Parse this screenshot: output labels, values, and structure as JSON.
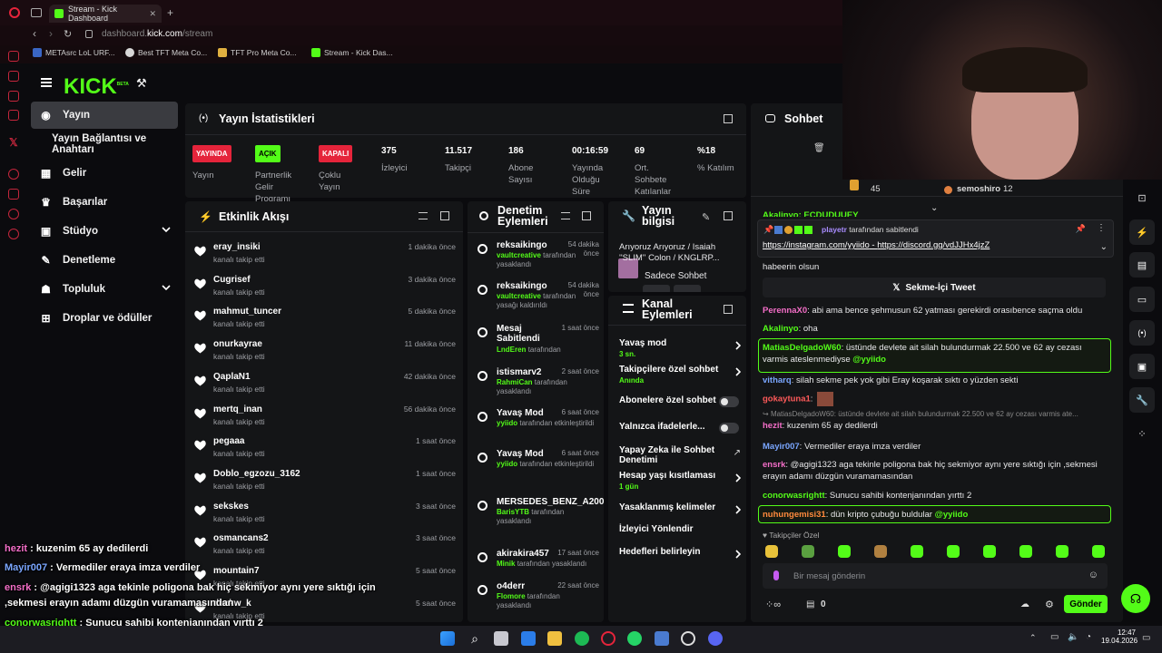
{
  "browser": {
    "tab_title": "Stream - Kick Dashboard",
    "url_prefix": "dashboard.",
    "url_domain": "kick.com",
    "url_path": "/stream",
    "bookmarks": [
      "METAsrc LoL URF...",
      "Best TFT Meta Co...",
      "TFT Pro Meta Co...",
      "Stream - Kick Das..."
    ]
  },
  "nav": {
    "logo": "KICK",
    "logo_beta": "BETA",
    "items": [
      "Yayın",
      "Yayın Bağlantısı ve Anahtarı",
      "Gelir",
      "Başarılar",
      "Stüdyo",
      "Denetleme",
      "Topluluk",
      "Droplar ve ödüller"
    ]
  },
  "stats": {
    "title": "Yayın İstatistikleri",
    "items": [
      {
        "badge": "YAYINDA",
        "label": "Yayın",
        "badge_color": "#e5243b"
      },
      {
        "badge": "AÇIK",
        "label": "Partnerlik Gelir Programı",
        "badge_color": "#53fc18"
      },
      {
        "badge": "KAPALI",
        "label": "Çoklu Yayın",
        "badge_color": "#e5243b"
      },
      {
        "value": "375",
        "label": "İzleyici"
      },
      {
        "value": "11.517",
        "label": "Takipçi"
      },
      {
        "value": "186",
        "label": "Abone Sayısı"
      },
      {
        "value": "00:16:59",
        "label": "Yayında Olduğu Süre"
      },
      {
        "value": "69",
        "label": "Ort. Sohbete Katılanlar"
      },
      {
        "value": "%18",
        "label": "% Katılım"
      }
    ]
  },
  "activity": {
    "title": "Etkinlik Akışı",
    "items": [
      {
        "name": "eray_insiki",
        "sub": "kanalı takip etti",
        "time": "1 dakika önce"
      },
      {
        "name": "Cugrisef",
        "sub": "kanalı takip etti",
        "time": "3 dakika önce"
      },
      {
        "name": "mahmut_tuncer",
        "sub": "kanalı takip etti",
        "time": "5 dakika önce"
      },
      {
        "name": "onurkayrae",
        "sub": "kanalı takip etti",
        "time": "11 dakika önce"
      },
      {
        "name": "QaplaN1",
        "sub": "kanalı takip etti",
        "time": "42 dakika önce"
      },
      {
        "name": "mertq_inan",
        "sub": "kanalı takip etti",
        "time": "56 dakika önce"
      },
      {
        "name": "pegaaa",
        "sub": "kanalı takip etti",
        "time": "1 saat önce"
      },
      {
        "name": "Doblo_egzozu_3162",
        "sub": "kanalı takip etti",
        "time": "1 saat önce"
      },
      {
        "name": "sekskes",
        "sub": "kanalı takip etti",
        "time": "3 saat önce"
      },
      {
        "name": "osmancans2",
        "sub": "kanalı takip etti",
        "time": "3 saat önce"
      },
      {
        "name": "mountain7",
        "sub": "kanalı takip etti",
        "time": "5 saat önce"
      },
      {
        "name": "deakw_k",
        "sub": "kanalı takip etti",
        "time": "5 saat önce"
      }
    ]
  },
  "moderation": {
    "title": "Denetim Eylemleri",
    "items": [
      {
        "name": "reksaikingo",
        "time": "54 dakika önce",
        "who": "vaultcreative",
        "sub": "tarafından yasaklandı"
      },
      {
        "name": "reksaikingo",
        "time": "54 dakika önce",
        "who": "vaultcreative",
        "sub": "tarafından yasağı kaldırıldı"
      },
      {
        "name": "Mesaj Sabitlendi",
        "time": "1 saat önce",
        "who": "LndEren",
        "sub": "tarafından"
      },
      {
        "name": "istismarv2",
        "time": "2 saat önce",
        "who": "RahmiCan",
        "sub": "tarafından yasaklandı"
      },
      {
        "name": "Yavaş Mod",
        "time": "6 saat önce",
        "who": "yyiido",
        "sub": "tarafından etkinleştirildi"
      },
      {
        "name": "Yavaş Mod",
        "time": "6 saat önce",
        "who": "yyiido",
        "sub": "tarafından etkinleştirildi"
      },
      {
        "name": "MERSEDES_BENZ_A200",
        "time": "",
        "who": "BarisYTB",
        "sub": "tarafından yasaklandı"
      },
      {
        "name": "akirakira457",
        "time": "17 saat önce",
        "who": "Minik",
        "sub": "tarafından yasaklandı"
      },
      {
        "name": "o4derr",
        "time": "22 saat önce",
        "who": "Flomore",
        "sub": "tarafından yasaklandı"
      }
    ]
  },
  "stream_info": {
    "title": "Yayın bilgisi",
    "stream_title": "Arıyoruz Arıyoruz / Isaiah ''SLIM'' Colon / KNGLRP...",
    "category": "Sadece Sohbet"
  },
  "channel_actions": {
    "title": "Kanal Eylemleri",
    "items": [
      {
        "label": "Yavaş mod",
        "sub": "3 sn.",
        "type": "arrow"
      },
      {
        "label": "Takipçilere özel sohbet",
        "sub": "Anında",
        "type": "arrow"
      },
      {
        "label": "Abonelere özel sohbet",
        "sub": "",
        "type": "toggle"
      },
      {
        "label": "Yalnızca ifadelerle...",
        "sub": "",
        "type": "toggle"
      },
      {
        "label": "Yapay Zeka ile Sohbet Denetimi",
        "sub": "",
        "type": "link"
      },
      {
        "label": "Hesap yaşı kısıtlaması",
        "sub": "1 gün",
        "type": "arrow"
      },
      {
        "label": "Yasaklanmış kelimeler",
        "sub": "",
        "type": "arrow"
      },
      {
        "label": "İzleyici Yönlendir",
        "sub": "",
        "type": "none"
      },
      {
        "label": "Hedefleri belirleyin",
        "sub": "",
        "type": "arrow"
      }
    ]
  },
  "chat": {
    "title": "Sohbet",
    "top_gifters": [
      {
        "count": "45"
      },
      {
        "name": "semoshiro",
        "count": "12"
      }
    ],
    "partial_top": "Akalinyo: ECDUDUUEY",
    "pinned": {
      "by": "playetr",
      "by_suffix": "tarafından sabitlendi",
      "link1": "https://instagram.com/yyiido",
      "sep": " - ",
      "link2": "https://discord.gg/vdJJHx4jzZ"
    },
    "partial": "habeerin olsun",
    "tweet_button": "Sekme-İçi Tweet",
    "messages": [
      {
        "user": "PerennaX0",
        "color": "#f46ec8",
        "text": "abi ama bence şehmusun 62 yatması gerekirdi orasıbence saçma oldu"
      },
      {
        "user": "Akalinyo",
        "color": "#53fc18",
        "text": "oha"
      },
      {
        "user": "MatiasDelgadoW60",
        "color": "#53fc18",
        "text": "üstünde devlete ait silah bulundurmak 22.500 ve 62 ay cezası varmis ateslenmediyse",
        "mention": "@yyiido"
      },
      {
        "user": "vitharq",
        "color": "#7aa6ff",
        "text": "silah sekme pek yok gibi Eray koşarak sıktı o yüzden sekti"
      },
      {
        "user": "gokaytuna1",
        "color": "#ff5a5a",
        "text": ""
      },
      {
        "reply": "MatiasDelgadoW60: üstünde devlete ait silah bulundurmak 22.500 ve 62 ay cezası varmis ate...",
        "user": "hezit",
        "color": "#f46ec8",
        "text": "kuzenim 65 ay dedilerdi"
      },
      {
        "user": "Mayir007",
        "color": "#7aa6ff",
        "text": "Vermediler eraya imza verdiler"
      },
      {
        "user": "ensrk",
        "color": "#f46ec8",
        "text": "@agigi1323 aga tekinle poligona bak hiç sekmiyor aynı yere sıktığı için ,sekmesi erayın adamı düzgün vuramamasından"
      },
      {
        "user": "conorwasrightt",
        "color": "#53fc18",
        "text": "Sunucu sahibi kontenjanından yırttı 2"
      },
      {
        "user": "nuhungemisi31",
        "color": "#ff8a3d",
        "text": "dün kripto çubuğu buldular",
        "mention": "@yyiido"
      }
    ],
    "followers_only": "Takipçiler Özel",
    "input_placeholder": "Bir mesaj gönderin",
    "points": "0",
    "send": "Gönder"
  },
  "overlay": [
    {
      "user": "hezit",
      "color": "#f46ec8",
      "text": "kuzenim 65 ay dedilerdi"
    },
    {
      "user": "Mayir007",
      "color": "#7aa6ff",
      "text": "Vermediler eraya imza verdiler"
    },
    {
      "user": "ensrk",
      "color": "#f46ec8",
      "text": "@agigi1323 aga tekinle poligona bak hiç sekmiyor aynı yere sıktığı için"
    },
    {
      "user": "",
      "color": "#fff",
      "text": ",sekmesi erayın adamı düzgün vuramamasından"
    },
    {
      "user": "conorwasrightt",
      "color": "#53fc18",
      "text": "Sunucu sahibi kontenjanından yırttı 2"
    },
    {
      "user": "nuhungemisi31",
      "color": "#ff8a3d",
      "text": "dün kripto çubuğu buldular",
      "mention": "@yyiido"
    }
  ],
  "taskbar": {
    "time": "12:47",
    "date": "19.04.2026"
  }
}
